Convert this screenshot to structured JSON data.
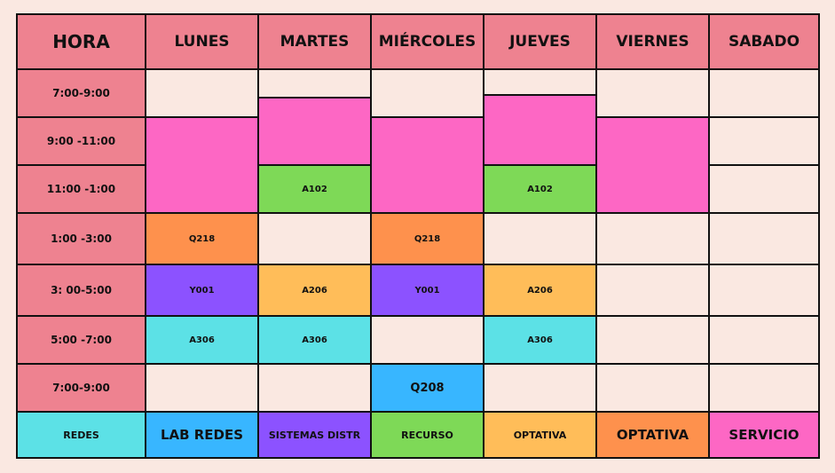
{
  "colors": {
    "background": "#fae8e1",
    "header": "#ee8290",
    "frame": "#8a5cf6",
    "pink": "#fd67c4",
    "green": "#7ed957",
    "orange": "#fe914d",
    "purple": "#8c52ff",
    "yellow": "#ffbd59",
    "cyan": "#5ce1e6",
    "blue": "#38b6ff"
  },
  "header": {
    "hora": "HORA",
    "days": [
      "LUNES",
      "MARTES",
      "MIÉRCOLES",
      "JUEVES",
      "VIERNES",
      "SABADO"
    ]
  },
  "times": [
    "7:00-9:00",
    "9:00 -11:00",
    "11:00 -1:00",
    "1:00 -3:00",
    "3: 00-5:00",
    "5:00 -7:00",
    "7:00-9:00"
  ],
  "rooms": {
    "martes_11": "A102",
    "jueves_11": "A102",
    "lunes_1": "Q218",
    "miercoles_1": "Q218",
    "lunes_3": "Y001",
    "martes_3": "A206",
    "miercoles_3": "Y001",
    "jueves_3": "A206",
    "lunes_5": "A306",
    "martes_5": "A306",
    "jueves_5": "A306",
    "miercoles_7": "Q208"
  },
  "legend": {
    "redes": "REDES",
    "lab_redes": "LAB REDES",
    "sistemas": "SISTEMAS DISTR",
    "recurso": "RECURSO",
    "optativa1": "OPTATIVA",
    "optativa2": "OPTATIVA",
    "servicio": "SERVICIO"
  }
}
